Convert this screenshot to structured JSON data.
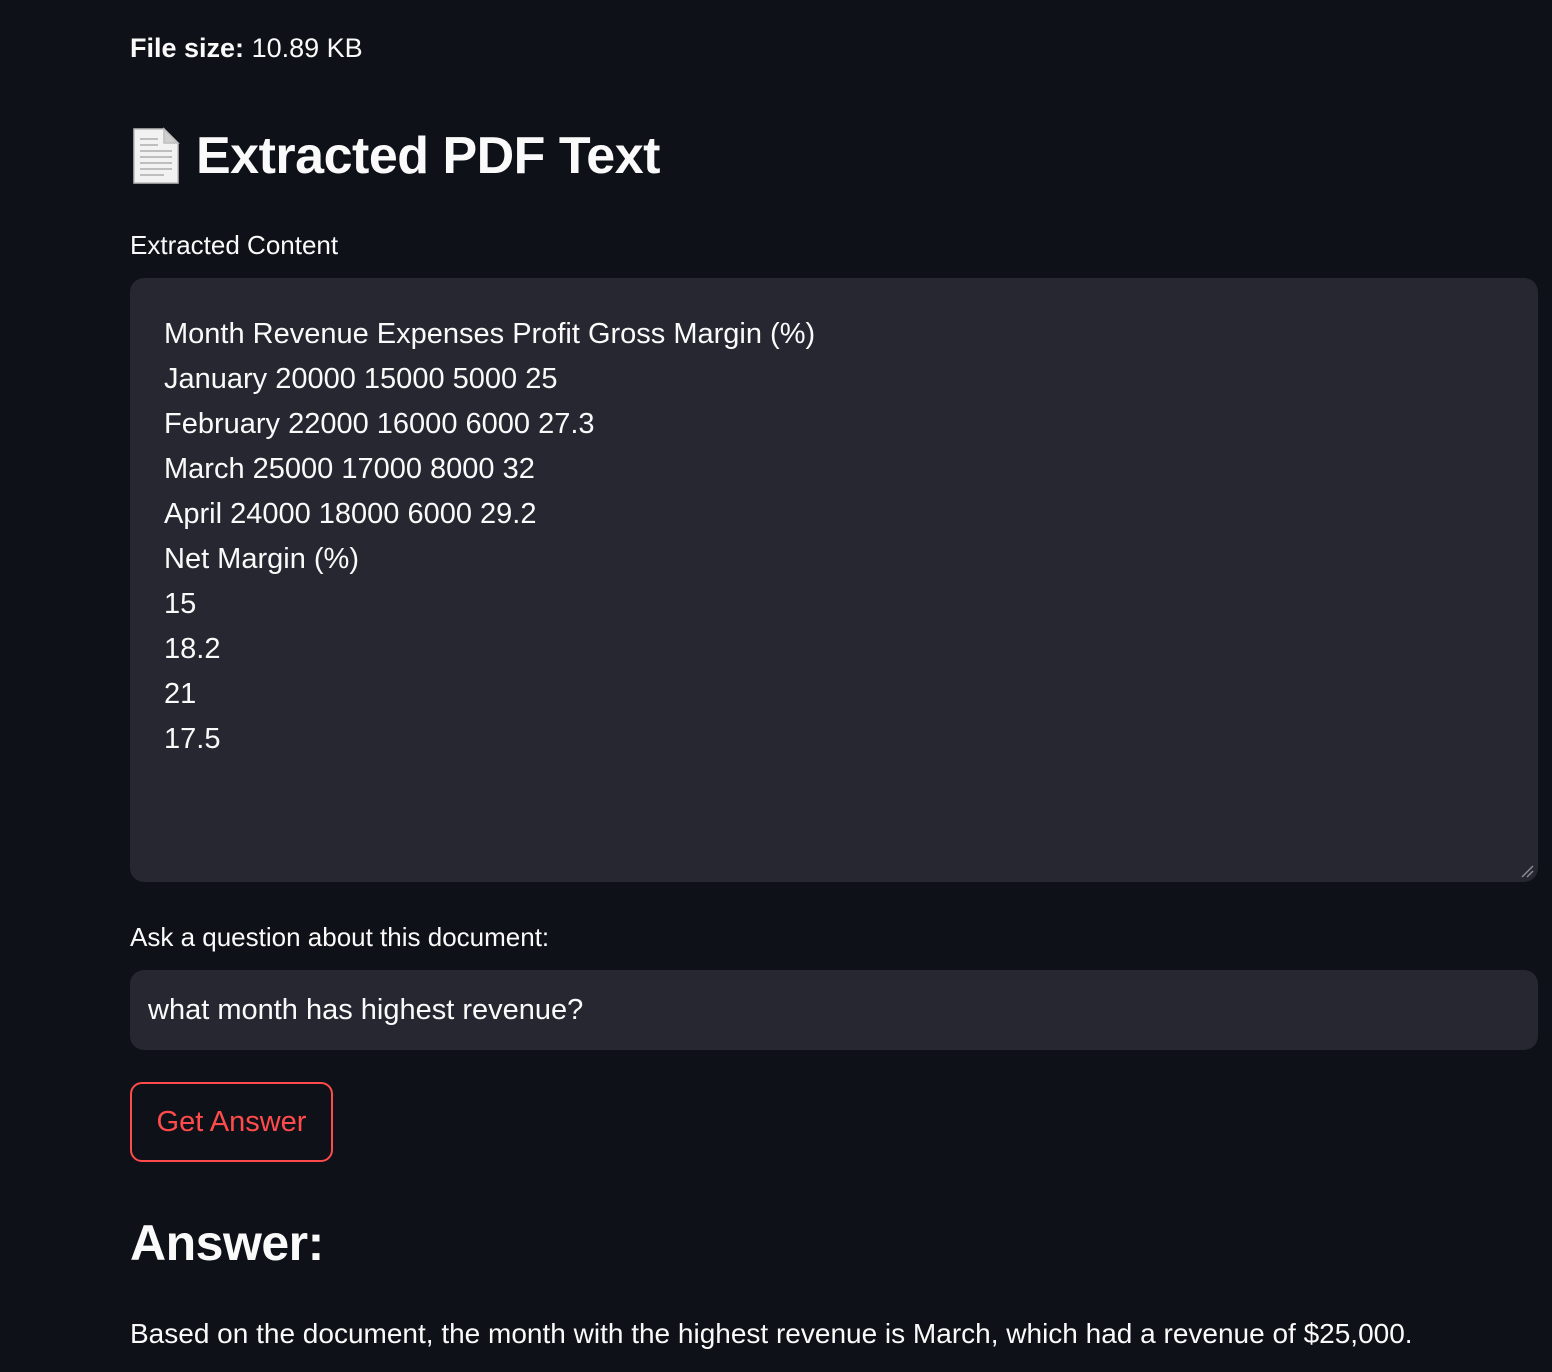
{
  "file_info": {
    "size_label": "File size:",
    "size_value": "10.89 KB"
  },
  "section": {
    "icon": "document-icon",
    "title": "Extracted PDF Text"
  },
  "extracted": {
    "label": "Extracted Content",
    "lines": [
      "Month Revenue Expenses Profit Gross Margin (%)",
      "January 20000 15000 5000 25",
      "February 22000 16000 6000 27.3",
      "March 25000 17000 8000 32",
      "April 24000 18000 6000 29.2",
      "Net Margin (%)",
      "15",
      "18.2",
      "21",
      "17.5"
    ]
  },
  "question": {
    "label": "Ask a question about this document:",
    "value": "what month has highest revenue?"
  },
  "action": {
    "button_label": "Get Answer"
  },
  "answer": {
    "heading": "Answer:",
    "text": "Based on the document, the month with the highest revenue is March, which had a revenue of $25,000."
  },
  "colors": {
    "background": "#0e1117",
    "input_bg": "#262730",
    "accent": "#ff4b4b",
    "text": "#fafafa"
  }
}
